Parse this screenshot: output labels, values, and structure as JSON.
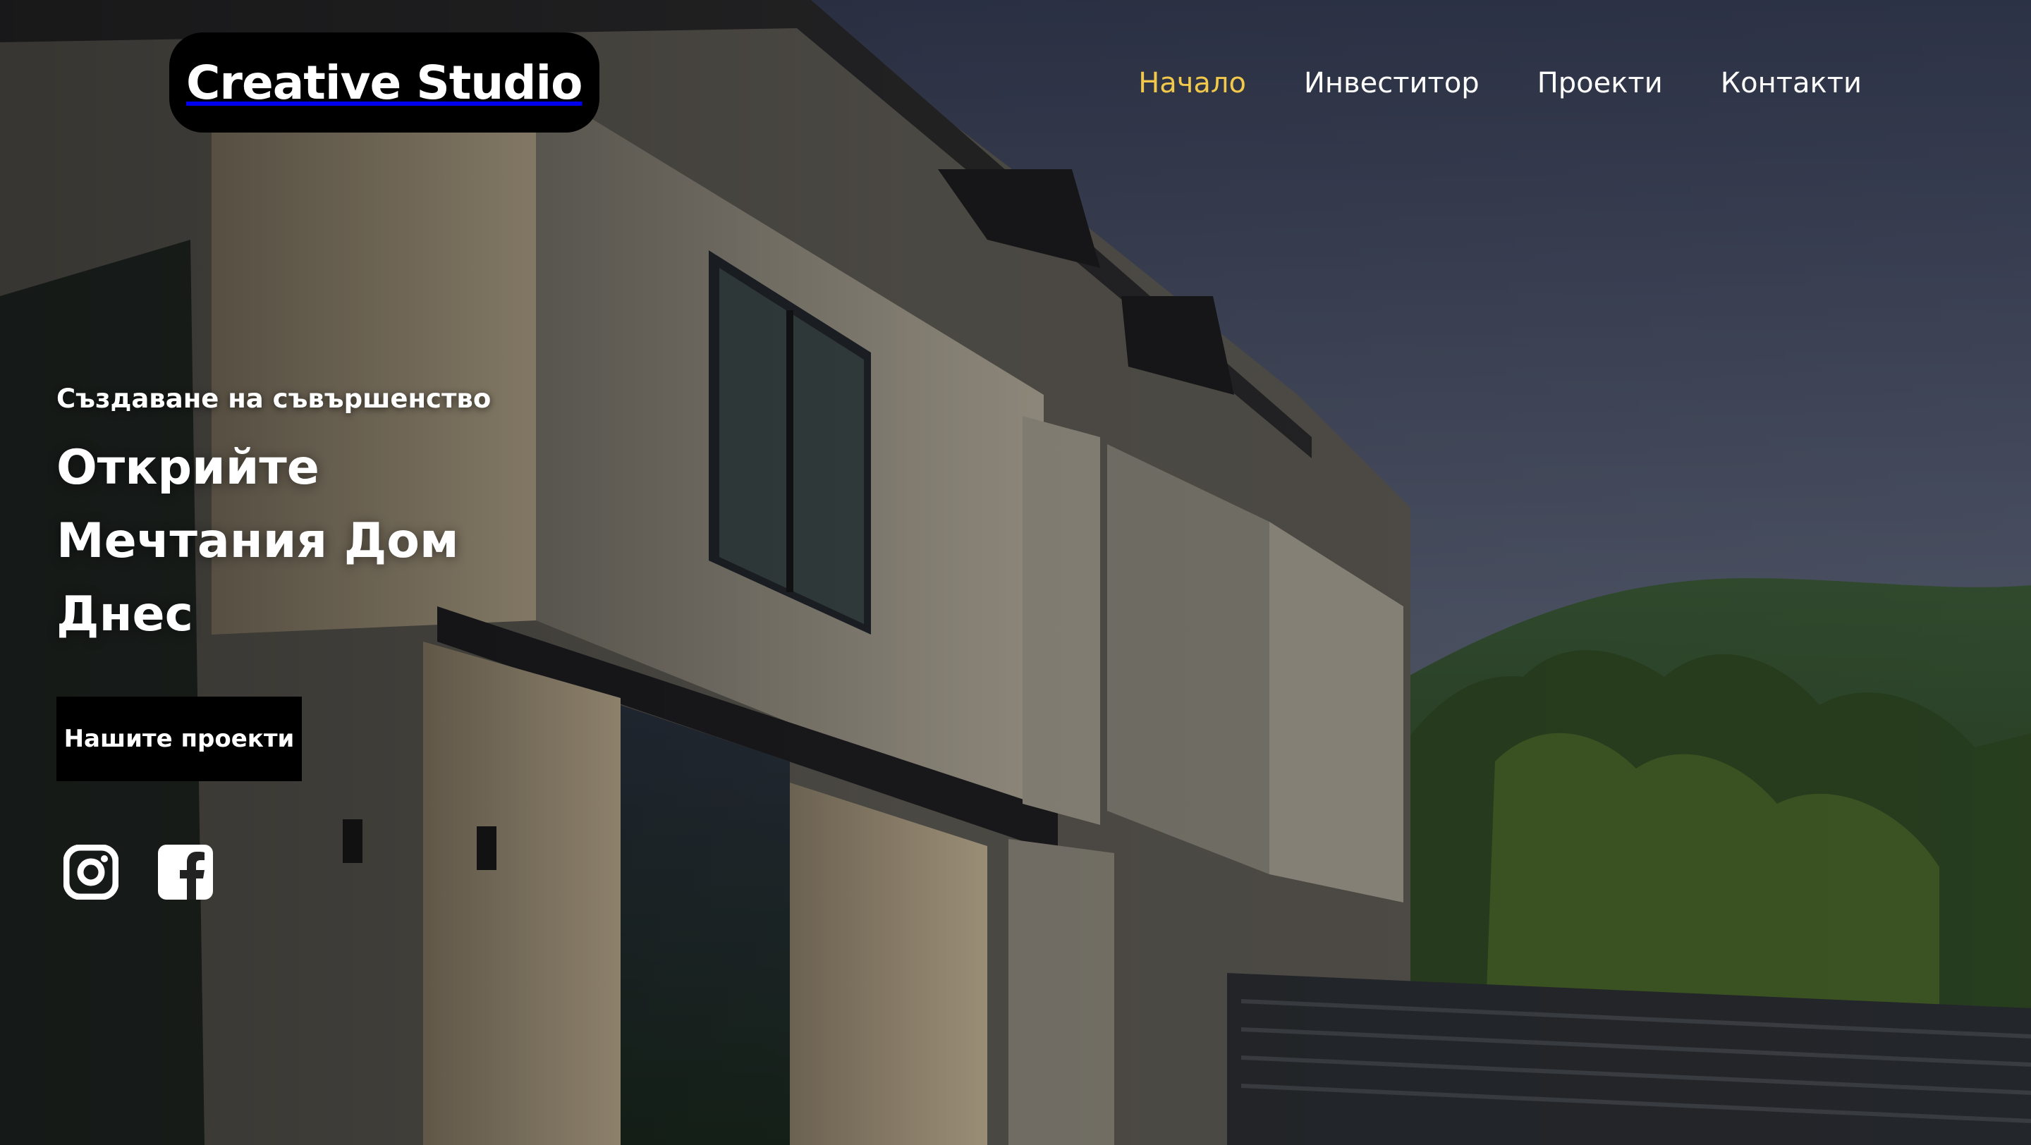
{
  "header": {
    "logo_text": "Creative Studio",
    "nav": [
      {
        "label": "Начало",
        "active": true
      },
      {
        "label": "Инвеститор",
        "active": false
      },
      {
        "label": "Проекти",
        "active": false
      },
      {
        "label": "Контакти",
        "active": false
      }
    ]
  },
  "hero": {
    "tagline": "Създаване на съвършенство",
    "headline": "Открийте Мечтания Дом Днес",
    "cta_label": "Нашите проекти",
    "background": "photo-of-modern-house-facade-with-mountains"
  },
  "social": {
    "items": [
      {
        "icon": "instagram-icon"
      },
      {
        "icon": "facebook-icon"
      }
    ]
  },
  "colors": {
    "accent": "#f2c84b",
    "button_bg": "#000000",
    "text": "#ffffff"
  }
}
